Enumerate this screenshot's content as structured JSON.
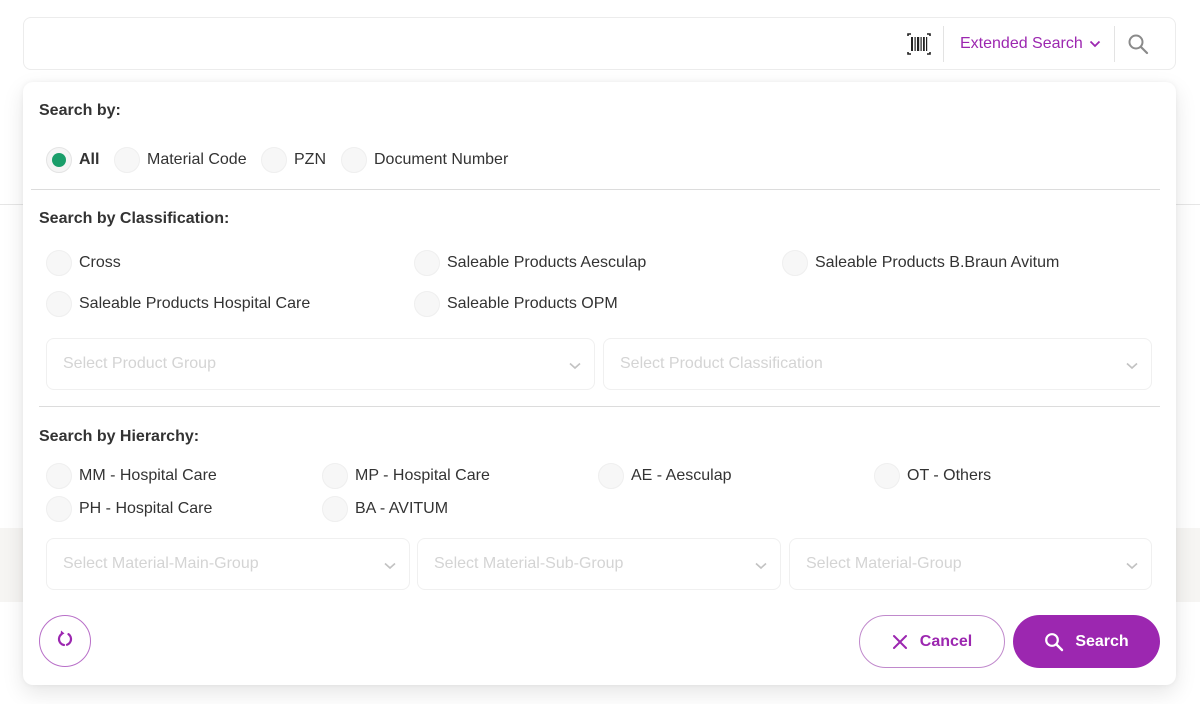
{
  "colors": {
    "accent": "#9c27b0",
    "selected_radio": "#1a9e6a",
    "placeholder": "#d4d4d4",
    "text": "#333333"
  },
  "top_bar": {
    "barcode_icon": "barcode-icon",
    "extended_search_label": "Extended Search",
    "extended_search_icon": "chevron-down-icon",
    "search_icon": "search-icon"
  },
  "search_by": {
    "title": "Search by:",
    "options": [
      {
        "label": "All",
        "selected": true
      },
      {
        "label": "Material Code",
        "selected": false
      },
      {
        "label": "PZN",
        "selected": false
      },
      {
        "label": "Document Number",
        "selected": false
      }
    ]
  },
  "classification": {
    "title": "Search by Classification:",
    "options": [
      {
        "label": "Cross",
        "selected": false
      },
      {
        "label": "Saleable Products Aesculap",
        "selected": false
      },
      {
        "label": "Saleable Products B.Braun Avitum",
        "selected": false
      },
      {
        "label": "Saleable Products Hospital Care",
        "selected": false
      },
      {
        "label": "Saleable Products OPM",
        "selected": false
      }
    ],
    "selects": [
      {
        "placeholder": "Select Product Group"
      },
      {
        "placeholder": "Select Product Classification"
      }
    ]
  },
  "hierarchy": {
    "title": "Search by Hierarchy:",
    "options": [
      {
        "label": "MM - Hospital Care",
        "selected": false
      },
      {
        "label": "MP - Hospital Care",
        "selected": false
      },
      {
        "label": "AE - Aesculap",
        "selected": false
      },
      {
        "label": "OT - Others",
        "selected": false
      },
      {
        "label": "PH - Hospital Care",
        "selected": false
      },
      {
        "label": "BA - AVITUM",
        "selected": false
      }
    ],
    "selects": [
      {
        "placeholder": "Select Material-Main-Group"
      },
      {
        "placeholder": "Select Material-Sub-Group"
      },
      {
        "placeholder": "Select Material-Group"
      }
    ]
  },
  "footer": {
    "reset_icon": "refresh-icon",
    "cancel_label": "Cancel",
    "cancel_icon": "close-icon",
    "search_label": "Search",
    "search_icon": "search-icon"
  }
}
